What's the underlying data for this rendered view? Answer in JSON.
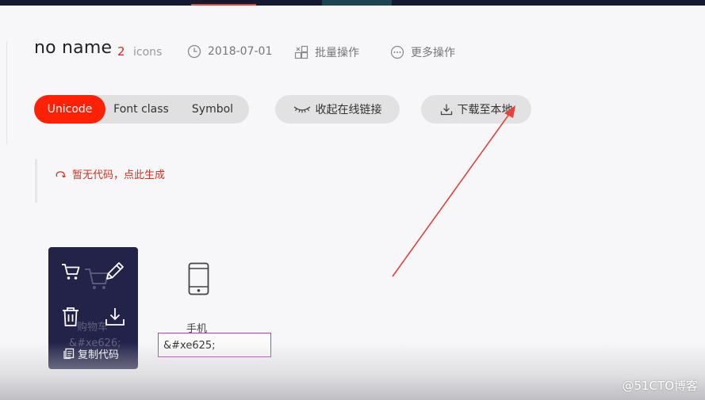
{
  "project": {
    "name": "no name",
    "count": "2",
    "count_label": "icons",
    "date": "2018-07-01",
    "batch_label": "批量操作",
    "more_label": "更多操作"
  },
  "tabs": {
    "unicode": "Unicode",
    "font_class": "Font class",
    "symbol": "Symbol",
    "active": "Unicode"
  },
  "actions": {
    "collapse_label": "收起在线链接",
    "download_label": "下载至本地"
  },
  "notice": {
    "text": "暂无代码，点此生成"
  },
  "icons": [
    {
      "name": "购物车",
      "code": "&#xe626;",
      "hover_actions": {
        "copy_label": "复制代码"
      }
    },
    {
      "name": "手机",
      "code": "&#xe625;"
    }
  ],
  "watermark": "@51CTO博客",
  "colors": {
    "accent": "#ff2105",
    "notice": "#d1321e",
    "card_bg": "#23234a",
    "highlight_box": "#d12fd1",
    "annotation_arrow": "#e8403c"
  }
}
